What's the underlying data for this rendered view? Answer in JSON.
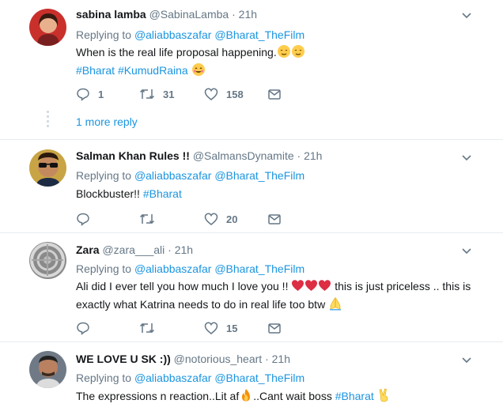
{
  "tweets": [
    {
      "name": "sabina lamba",
      "handle": "@SabinaLamba",
      "time": "· 21h",
      "replying_label": "Replying to",
      "mention1": "@aliabbaszafar",
      "mention2": "@Bharat_TheFilm",
      "text1": "When is the real life proposal happening.",
      "hashtag1": "#Bharat",
      "hashtag2": "#KumudRaina",
      "reply_count": "1",
      "retweet_count": "31",
      "like_count": "158",
      "more_reply": "1 more reply"
    },
    {
      "name": "Salman Khan Rules !!",
      "handle": "@SalmansDynamite",
      "time": "· 21h",
      "replying_label": "Replying to",
      "mention1": "@aliabbaszafar",
      "mention2": "@Bharat_TheFilm",
      "text1": "Blockbuster!!",
      "hashtag1": "#Bharat",
      "like_count": "20"
    },
    {
      "name": "Zara",
      "handle": "@zara___ali",
      "time": "· 21h",
      "replying_label": "Replying to",
      "mention1": "@aliabbaszafar",
      "mention2": "@Bharat_TheFilm",
      "text1": "Ali did I ever tell you how much I love you !!",
      "text2": "this is just priceless .. this is exactly what Katrina needs to do in real life too btw",
      "like_count": "15"
    },
    {
      "name": "WE LOVE U SK :))",
      "handle": "@notorious_heart",
      "time": "· 21h",
      "replying_label": "Replying to",
      "mention1": "@aliabbaszafar",
      "mention2": "@Bharat_TheFilm",
      "text1": "The expressions n reaction..Lit af",
      "text2": "..Cant wait boss",
      "hashtag1": "#Bharat"
    }
  ],
  "colors": {
    "link": "#1b95e0",
    "meta": "#657786",
    "divider": "#e6ecf0",
    "heart": "#e0245e"
  },
  "icons": [
    "reply-icon",
    "retweet-icon",
    "like-icon",
    "dm-icon",
    "chevron-down-icon"
  ]
}
